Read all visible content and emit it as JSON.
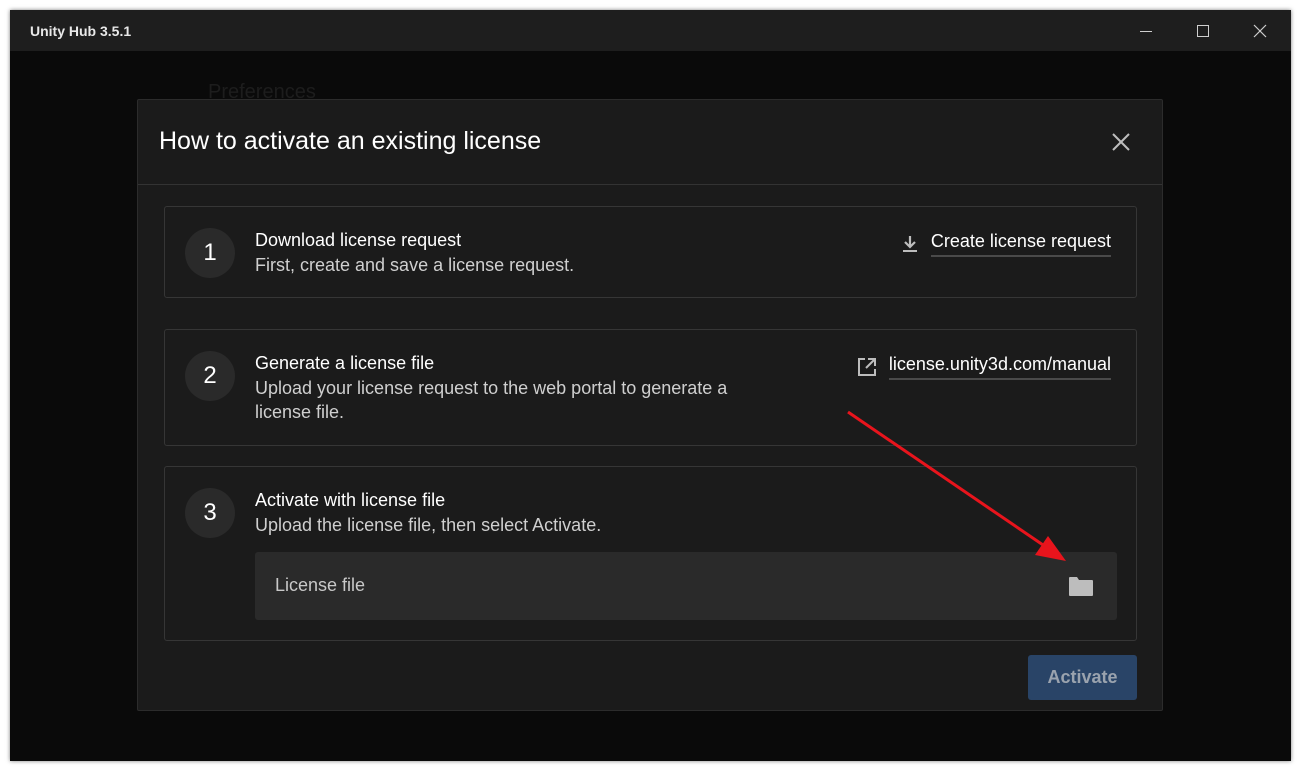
{
  "window": {
    "title": "Unity Hub 3.5.1"
  },
  "background": {
    "section_title": "Preferences"
  },
  "dialog": {
    "title": "How to activate an existing license",
    "steps": [
      {
        "number": "1",
        "title": "Download license request",
        "description": "First, create and save a license request.",
        "action_label": "Create license request",
        "action_icon": "download-icon"
      },
      {
        "number": "2",
        "title": "Generate a license file",
        "description": "Upload your license request to the web portal to generate a license file.",
        "action_label": "license.unity3d.com/manual",
        "action_icon": "external-link-icon"
      },
      {
        "number": "3",
        "title": "Activate with license file",
        "description": "Upload the license file, then select Activate.",
        "field_label": "License file",
        "field_icon": "folder-icon"
      }
    ],
    "activate_label": "Activate"
  },
  "colors": {
    "accent_button": "#294467",
    "annotation_arrow": "#e8141c"
  }
}
